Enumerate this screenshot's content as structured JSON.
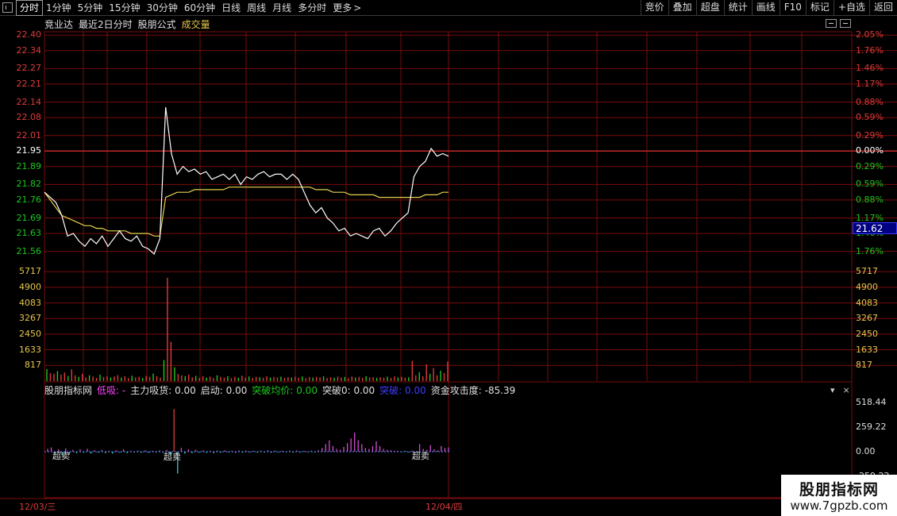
{
  "toolbar": {
    "period_tabs": [
      "分时",
      "1分钟",
      "5分钟",
      "15分钟",
      "30分钟",
      "60分钟",
      "日线",
      "周线",
      "月线",
      "多分时",
      "更多"
    ],
    "more_arrow": ">",
    "tools": [
      "竞价",
      "叠加",
      "超盘",
      "统计",
      "画线",
      "F10",
      "标记",
      "+自选",
      "返回"
    ]
  },
  "title": {
    "stock_name": "竞业达",
    "mode": "最近2日分时",
    "formula": "股朋公式",
    "volume": "成交量"
  },
  "price_axis": {
    "left": [
      "22.40",
      "22.34",
      "22.27",
      "22.21",
      "22.14",
      "22.08",
      "22.01",
      "21.95",
      "21.89",
      "21.82",
      "21.76",
      "21.69",
      "21.63",
      "21.56"
    ],
    "right": [
      "2.05%",
      "1.76%",
      "1.46%",
      "1.17%",
      "0.88%",
      "0.59%",
      "0.29%",
      "0.00%",
      "0.29%",
      "0.59%",
      "0.88%",
      "1.17%",
      "1.46%",
      "1.76%"
    ],
    "current_price": "21.62"
  },
  "volume_axis": [
    "5717",
    "4900",
    "4083",
    "3267",
    "2450",
    "1633",
    "817"
  ],
  "indicator": {
    "name": "股朋指标网",
    "low_absorb": "低吸: -",
    "main_buy": "主力吸货: 0.00",
    "start": "启动: 0.00",
    "break_avg": "突破均价: 0.00",
    "break0": "突破0: 0.00",
    "break": "突破: 0.00",
    "fund_attack": "资金攻击度: -85.39",
    "axis": [
      "518.44",
      "259.22",
      "0.00",
      "-259.22"
    ],
    "notes": [
      "超卖",
      "超卖",
      "超卖"
    ],
    "tools": [
      "▾",
      "×"
    ]
  },
  "dates": [
    "12/03/三",
    "12/04/四"
  ],
  "watermark": {
    "title": "股朋指标网",
    "url": "www.7gpzb.com"
  },
  "colors": {
    "grid": "#7a0c0c",
    "up": "#e03b3b",
    "down": "#1ec81e",
    "flat": "#ffffff",
    "price_line": "#ffffff",
    "avg_line": "#e6d24a",
    "volume_label": "#e6c64c"
  },
  "chart_data": {
    "type": "line",
    "title": "最近2日分时",
    "xlabel": "",
    "ylabel": "",
    "ylim": [
      21.51,
      22.41
    ],
    "reference_price": 21.95,
    "categories": [
      "12/03/三",
      "12/04/四"
    ],
    "series": [
      {
        "name": "",
        "values": [
          21.79,
          21.77,
          21.75,
          21.7,
          21.62,
          21.63,
          21.6,
          21.58,
          21.61,
          21.59,
          21.62,
          21.58,
          21.61,
          21.64,
          21.61,
          21.6,
          21.62,
          21.58,
          21.57,
          21.55,
          21.61,
          22.12,
          21.94,
          21.86,
          21.89,
          21.87,
          21.88,
          21.86,
          21.87,
          21.84,
          21.85,
          21.86,
          21.84,
          21.86,
          21.82,
          21.85,
          21.84,
          21.86,
          21.87,
          21.85,
          21.86,
          21.86,
          21.84,
          21.86,
          21.84,
          21.79,
          21.74,
          21.71,
          21.73,
          21.69,
          21.67,
          21.64,
          21.65,
          21.62,
          21.63,
          21.62,
          21.61,
          21.64,
          21.65,
          21.62,
          21.64,
          21.67,
          21.69,
          21.71,
          21.85,
          21.89,
          21.91,
          21.96,
          21.93,
          21.94,
          21.93
        ]
      },
      {
        "name": "",
        "values": [
          21.79,
          21.76,
          21.73,
          21.7,
          21.69,
          21.68,
          21.67,
          21.66,
          21.66,
          21.65,
          21.65,
          21.64,
          21.64,
          21.64,
          21.64,
          21.63,
          21.63,
          21.63,
          21.63,
          21.62,
          21.62,
          21.77,
          21.78,
          21.79,
          21.79,
          21.79,
          21.8,
          21.8,
          21.8,
          21.8,
          21.8,
          21.8,
          21.81,
          21.81,
          21.81,
          21.81,
          21.81,
          21.81,
          21.81,
          21.81,
          21.81,
          21.81,
          21.81,
          21.81,
          21.81,
          21.81,
          21.81,
          21.8,
          21.8,
          21.8,
          21.79,
          21.79,
          21.79,
          21.78,
          21.78,
          21.78,
          21.78,
          21.78,
          21.77,
          21.77,
          21.77,
          21.77,
          21.77,
          21.77,
          21.77,
          21.77,
          21.78,
          21.78,
          21.78,
          21.79,
          21.79
        ]
      }
    ],
    "volume": {
      "ylim": [
        0,
        6100
      ],
      "values": [
        620,
        410,
        380,
        520,
        330,
        440,
        260,
        610,
        300,
        220,
        380,
        180,
        300,
        240,
        160,
        330,
        210,
        260,
        190,
        240,
        310,
        180,
        250,
        150,
        280,
        190,
        230,
        160,
        270,
        220,
        390,
        260,
        180,
        1100,
        5400,
        2050,
        720,
        360,
        300,
        250,
        330,
        200,
        270,
        170,
        260,
        180,
        230,
        160,
        300,
        220,
        180,
        250,
        150,
        230,
        170,
        280,
        180,
        240,
        160,
        220,
        200,
        170,
        250,
        180,
        210,
        190,
        230,
        160,
        200,
        180,
        230,
        170,
        240,
        150,
        210,
        180,
        220,
        190,
        250,
        160,
        200,
        170,
        230,
        180,
        210,
        150,
        240,
        180,
        220,
        160,
        250,
        190,
        210,
        170,
        200,
        180,
        230,
        160,
        240,
        190,
        220,
        170,
        200,
        1050,
        300,
        460,
        250,
        870,
        380,
        680,
        300,
        540,
        420,
        1020
      ]
    },
    "indicator": {
      "ylim": [
        -259.22,
        518.44
      ],
      "values": [
        30,
        45,
        -20,
        25,
        -40,
        35,
        -30,
        20,
        -15,
        25,
        -10,
        30,
        -20,
        15,
        -10,
        20,
        -15,
        10,
        -20,
        15,
        -10,
        25,
        -15,
        10,
        -8,
        12,
        -10,
        15,
        -12,
        10,
        -8,
        15,
        -10,
        20,
        -30,
        450,
        -230,
        40,
        -20,
        25,
        -15,
        20,
        -10,
        15,
        -12,
        10,
        -15,
        12,
        -10,
        15,
        -8,
        10,
        -12,
        14,
        -10,
        12,
        -8,
        10,
        -10,
        12,
        -8,
        15,
        -10,
        12,
        -8,
        10,
        -6,
        12,
        -10,
        14,
        -8,
        10,
        -6,
        12,
        -8,
        15,
        40,
        80,
        120,
        60,
        30,
        20,
        50,
        90,
        140,
        200,
        120,
        80,
        40,
        30,
        60,
        110,
        60,
        30,
        20,
        15,
        10,
        8,
        -6,
        10,
        -8,
        12,
        -6,
        80,
        30,
        20,
        70,
        25,
        15,
        60,
        40,
        45
      ]
    }
  }
}
